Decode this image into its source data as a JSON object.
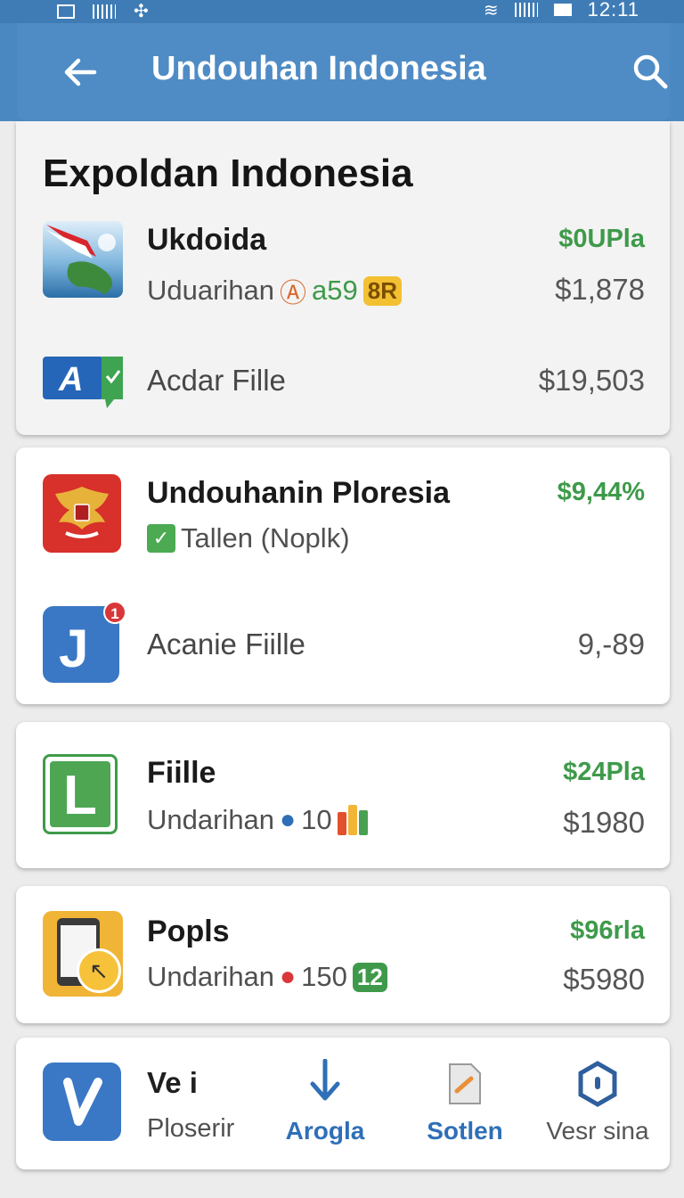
{
  "status_bar": {
    "time": "12:11"
  },
  "app_bar": {
    "title": "Undouhan Indonesia",
    "back_icon": "arrow-left-icon",
    "search_icon": "search-icon"
  },
  "section": {
    "title": "Expoldan Indonesia"
  },
  "items": [
    {
      "name": "Ukdoida",
      "subtitle": "Uduarihan",
      "badge_text": "a59",
      "badge2_text": "8R",
      "price_top": "$0UPla",
      "price_bottom": "$1,878",
      "icon": "map-flag-icon"
    },
    {
      "label": "Acdar Fille",
      "price": "$19,503",
      "icon": "a-check-icon"
    },
    {
      "name": "Undouhanin Ploresia",
      "subtitle": "Tallen (Noplk)",
      "price_top": "$9,44%",
      "icon": "garuda-emblem-icon"
    },
    {
      "label": "Acanie Fiille",
      "price": "9,-89",
      "icon": "j-app-icon",
      "notification_count": "1"
    },
    {
      "name": "Fiille",
      "subtitle": "Undarihan",
      "badge_text": "10",
      "price_top": "$24Pla",
      "price_bottom": "$1980",
      "icon": "l-app-icon"
    },
    {
      "name": "Popls",
      "subtitle": "Undarihan",
      "badge_text": "150",
      "badge2_text": "12",
      "price_top": "$96rla",
      "price_bottom": "$5980",
      "icon": "tablet-clock-icon"
    }
  ],
  "bottom_nav": {
    "brand_top": "Ve i",
    "brand_bottom": "Ploserir",
    "items": [
      {
        "label": "Arogla",
        "icon": "download-arrow-icon"
      },
      {
        "label": "Sotlen",
        "icon": "document-icon"
      },
      {
        "label": "Vesr sina",
        "icon": "hexagon-shield-icon"
      }
    ]
  },
  "colors": {
    "app_bar": "#4f8cc5",
    "price_green": "#3e9a4a",
    "nav_blue": "#2f6fb7"
  }
}
